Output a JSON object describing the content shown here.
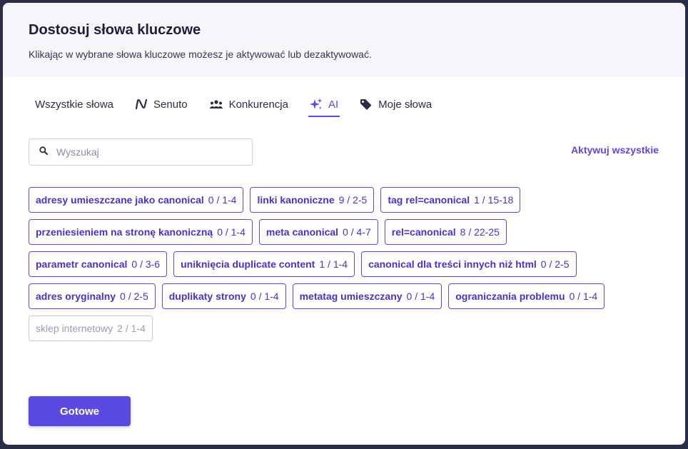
{
  "dialog": {
    "title": "Dostosuj słowa kluczowe",
    "subtitle": "Klikając w wybrane słowa kluczowe możesz je aktywować lub dezaktywować."
  },
  "tabs": [
    {
      "label": "Wszystkie słowa",
      "icon": "none"
    },
    {
      "label": "Senuto",
      "icon": "senuto-logo-icon"
    },
    {
      "label": "Konkurencja",
      "icon": "group-icon"
    },
    {
      "label": "AI",
      "icon": "sparkles-icon",
      "active": true
    },
    {
      "label": "Moje słowa",
      "icon": "tag-icon"
    }
  ],
  "search": {
    "placeholder": "Wyszukaj",
    "value": ""
  },
  "activate_all_label": "Aktywuj wszystkie",
  "keywords": [
    {
      "text": "adresy umieszczane jako canonical",
      "count": "0 / 1-4",
      "active": true
    },
    {
      "text": "linki kanoniczne",
      "count": "9 / 2-5",
      "active": true
    },
    {
      "text": "tag rel=canonical",
      "count": "1 / 15-18",
      "active": true
    },
    {
      "text": "przeniesieniem na stronę kanoniczną",
      "count": "0 / 1-4",
      "active": true
    },
    {
      "text": "meta canonical",
      "count": "0 / 4-7",
      "active": true
    },
    {
      "text": "rel=canonical",
      "count": "8 / 22-25",
      "active": true
    },
    {
      "text": "parametr canonical",
      "count": "0 / 3-6",
      "active": true
    },
    {
      "text": "uniknięcia duplicate content",
      "count": "1 / 1-4",
      "active": true
    },
    {
      "text": "canonical dla treści innych niż html",
      "count": "0 / 2-5",
      "active": true
    },
    {
      "text": "adres oryginalny",
      "count": "0 / 2-5",
      "active": true
    },
    {
      "text": "duplikaty strony",
      "count": "0 / 1-4",
      "active": true
    },
    {
      "text": "metatag umieszczany",
      "count": "0 / 1-4",
      "active": true
    },
    {
      "text": "ograniczania problemu",
      "count": "0 / 1-4",
      "active": true
    },
    {
      "text": "sklep internetowy",
      "count": "2 / 1-4",
      "active": false
    }
  ],
  "done_label": "Gotowe",
  "colors": {
    "accent": "#5b4ae0",
    "chip_text": "#4634c9",
    "inactive": "#9a9cae",
    "header_bg": "#f6f6fa"
  }
}
